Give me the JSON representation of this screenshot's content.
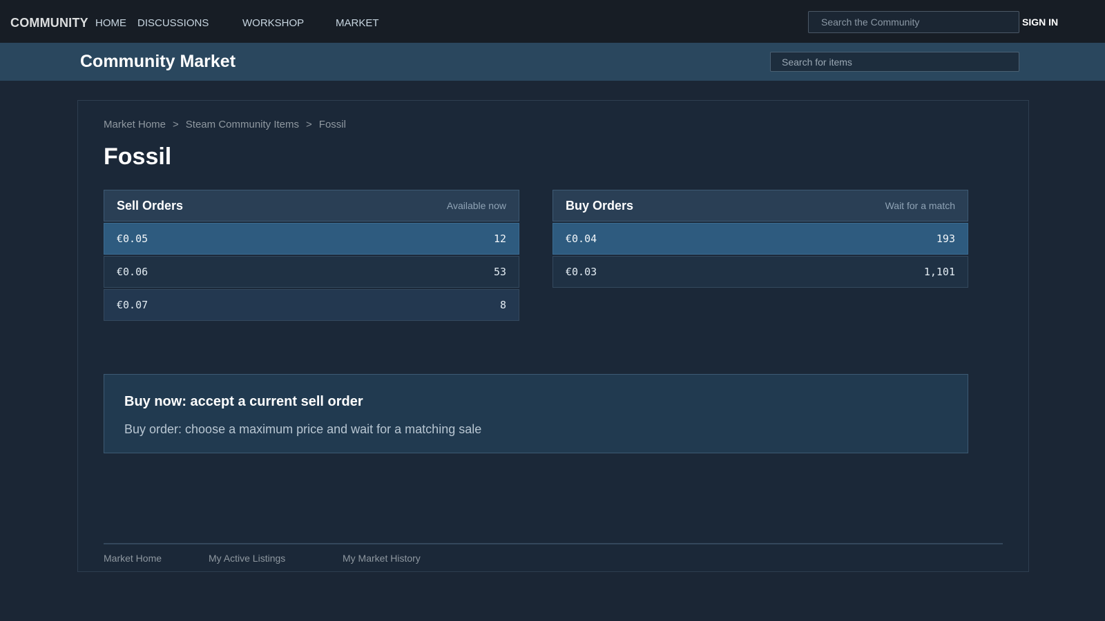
{
  "topnav": {
    "brand": "COMMUNITY",
    "links": [
      "HOME",
      "DISCUSSIONS",
      "WORKSHOP",
      "MARKET"
    ],
    "search_placeholder": "Search the Community",
    "signin_label": "SIGN IN"
  },
  "marketbar": {
    "title": "Community Market",
    "search_placeholder": "Search for items"
  },
  "breadcrumb": {
    "items": [
      "Market Home",
      "Steam Community Items",
      "Fossil"
    ],
    "separator": ">"
  },
  "item": {
    "title": "Fossil"
  },
  "sell_orders": {
    "title": "Sell Orders",
    "subtitle": "Available now",
    "rows": [
      {
        "price": "€0.05",
        "quantity": "12"
      },
      {
        "price": "€0.06",
        "quantity": "53"
      },
      {
        "price": "€0.07",
        "quantity": "8"
      }
    ]
  },
  "buy_orders": {
    "title": "Buy Orders",
    "subtitle": "Wait for a match",
    "rows": [
      {
        "price": "€0.04",
        "quantity": "193"
      },
      {
        "price": "€0.03",
        "quantity": "1,101"
      }
    ]
  },
  "info": {
    "line1": "Buy now: accept a current sell order",
    "line2": "Buy order: choose a maximum price and wait for a matching sale"
  },
  "footer": {
    "links": [
      "Market Home",
      "My Active Listings",
      "My Market History"
    ]
  },
  "colors": {
    "page_bg": "#1b2635",
    "topbar_bg": "#171d25",
    "marketbar_bg": "#2a475e",
    "highlight_row": "#2e5b7f"
  }
}
